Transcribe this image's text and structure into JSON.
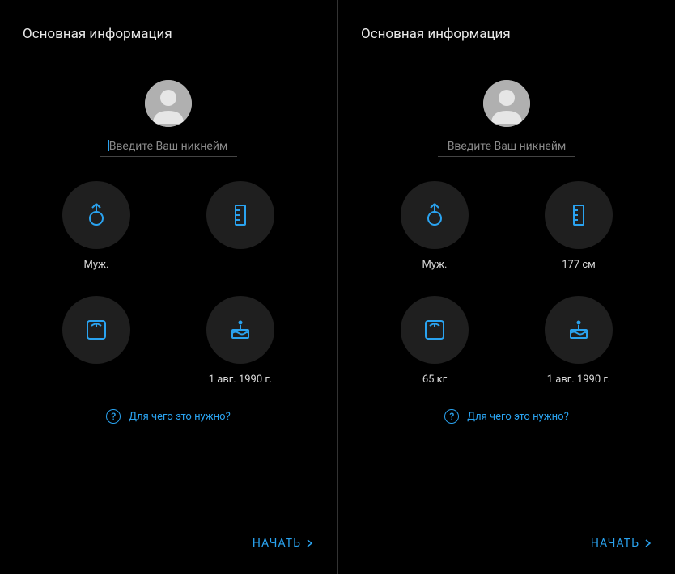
{
  "left": {
    "title": "Основная информация",
    "nickname_placeholder": "Введите Ваш никнейм",
    "nickname_has_cursor": true,
    "cells": {
      "gender": {
        "label": "Муж."
      },
      "height": {
        "label": ""
      },
      "weight": {
        "label": ""
      },
      "birthday": {
        "label": "1 авг. 1990 г."
      }
    },
    "help_text": "Для чего это нужно?",
    "start_label": "НАЧАТЬ"
  },
  "right": {
    "title": "Основная информация",
    "nickname_placeholder": "Введите Ваш никнейм",
    "nickname_has_cursor": false,
    "cells": {
      "gender": {
        "label": "Муж."
      },
      "height": {
        "label": "177 см"
      },
      "weight": {
        "label": "65 кг"
      },
      "birthday": {
        "label": "1 авг. 1990 г."
      }
    },
    "help_text": "Для чего это нужно?",
    "start_label": "НАЧАТЬ"
  },
  "colors": {
    "accent": "#2aa3f0",
    "circle": "#1f1f1f"
  }
}
